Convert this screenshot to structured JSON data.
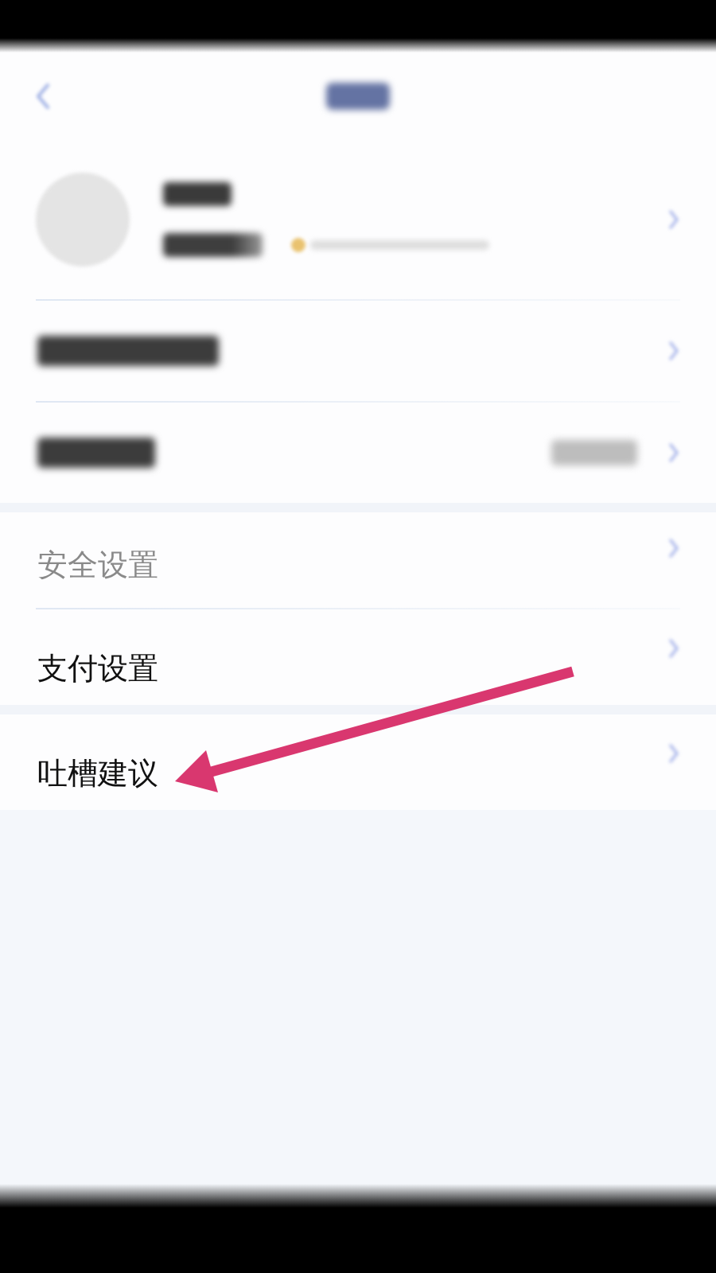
{
  "sections": [
    {
      "items": [
        {
          "kind": "profile"
        },
        {
          "kind": "hidden",
          "detail": false
        },
        {
          "kind": "hidden",
          "detail": true
        }
      ]
    },
    {
      "items": [
        {
          "kind": "text",
          "label": "安全设置",
          "faded": true
        },
        {
          "kind": "text",
          "label": "支付设置",
          "faded": false
        }
      ]
    },
    {
      "items": [
        {
          "kind": "text",
          "label": "吐槽建议",
          "faded": false
        }
      ]
    }
  ]
}
